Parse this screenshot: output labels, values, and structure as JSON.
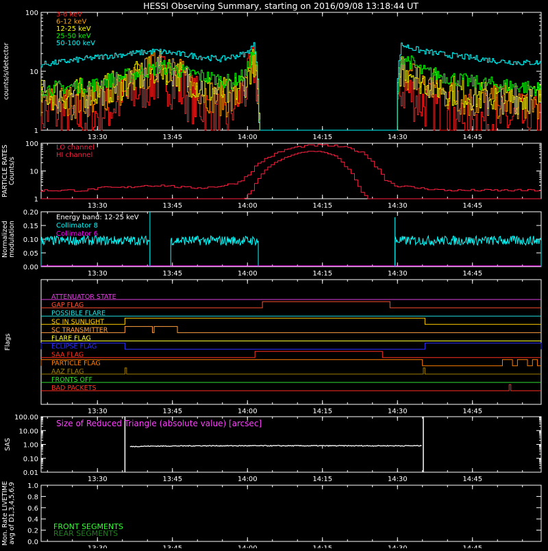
{
  "title": "HESSI Observing Summary, starting on 2016/09/08 13:18:44 UT",
  "time_axis": {
    "start": "13:18:44",
    "end": "14:58:44",
    "ticks": [
      "13:30",
      "13:45",
      "14:00",
      "14:15",
      "14:30",
      "14:45"
    ]
  },
  "chart_data": [
    {
      "name": "count-rates",
      "type": "line",
      "ylabel": "counts/s/detector",
      "yscale": "log",
      "ylim": [
        1,
        100
      ],
      "yticks": [
        "1",
        "10",
        "100"
      ],
      "series": [
        {
          "name": "3-6 keV",
          "color": "#ff2020",
          "x": [
            "13:18:44",
            "13:22",
            "13:28",
            "13:33",
            "13:37",
            "13:40",
            "13:43",
            "13:48",
            "13:52",
            "13:56",
            "14:00",
            "14:01:30",
            "14:02:30",
            "14:29",
            "14:30",
            "14:31",
            "14:35",
            "14:40",
            "14:45",
            "14:50",
            "14:55",
            "14:58:44"
          ],
          "y": [
            2,
            2,
            1.5,
            2.5,
            4,
            6,
            8,
            4,
            2.2,
            1.5,
            5,
            12,
            1,
            1,
            1,
            5,
            3,
            1.8,
            1.5,
            1.5,
            1.5,
            1.5
          ]
        },
        {
          "name": "6-12 keV",
          "color": "#ffa000",
          "x": [
            "13:18:44",
            "13:25",
            "13:30",
            "13:35",
            "13:40",
            "13:43",
            "13:47",
            "13:52",
            "13:57",
            "14:00",
            "14:01:30",
            "14:02:30",
            "14:29",
            "14:30",
            "14:31",
            "14:35",
            "14:40",
            "14:45",
            "14:50",
            "14:55",
            "14:58:44"
          ],
          "y": [
            3,
            3,
            3.5,
            5,
            9,
            14,
            8,
            4,
            3,
            5,
            14,
            1,
            1,
            1,
            11,
            6,
            4,
            3,
            3,
            3,
            3
          ]
        },
        {
          "name": "12-25 keV",
          "color": "#ffff00",
          "x": [
            "13:18:44",
            "13:25",
            "13:30",
            "13:35",
            "13:40",
            "13:43",
            "13:47",
            "13:52",
            "13:57",
            "14:00",
            "14:01:30",
            "14:02:30",
            "14:29",
            "14:30",
            "14:31",
            "14:35",
            "14:40",
            "14:45",
            "14:50",
            "14:55",
            "14:58:44"
          ],
          "y": [
            4,
            4,
            4.5,
            6,
            9,
            12,
            8,
            5,
            4,
            7,
            15,
            1,
            1,
            1,
            13,
            7,
            5,
            4,
            3.5,
            3.5,
            3.5
          ]
        },
        {
          "name": "25-50 keV",
          "color": "#00ff00",
          "x": [
            "13:18:44",
            "13:25",
            "13:30",
            "13:35",
            "13:40",
            "13:43",
            "13:47",
            "13:52",
            "13:57",
            "14:00",
            "14:01:30",
            "14:02:30",
            "14:29",
            "14:30",
            "14:31",
            "14:35",
            "14:40",
            "14:45",
            "14:50",
            "14:55",
            "14:58:44"
          ],
          "y": [
            5,
            5.5,
            6,
            8,
            10,
            12,
            10,
            8,
            6.5,
            9,
            22,
            1,
            1,
            1,
            18,
            10,
            8,
            6.5,
            6,
            5.5,
            5
          ]
        },
        {
          "name": "50-100 keV",
          "color": "#00ffff",
          "x": [
            "13:18:44",
            "13:22",
            "13:27",
            "13:32",
            "13:37",
            "13:42",
            "13:46",
            "13:50",
            "13:55",
            "14:00",
            "14:01:30",
            "14:02:30",
            "14:29",
            "14:30",
            "14:31",
            "14:35",
            "14:40",
            "14:45",
            "14:50",
            "14:55",
            "14:58:44"
          ],
          "y": [
            13,
            14,
            16,
            18,
            20,
            22,
            20,
            18,
            16,
            20,
            28,
            1,
            1,
            1,
            28,
            22,
            19,
            17,
            15,
            14,
            14
          ]
        }
      ]
    },
    {
      "name": "particle-rates",
      "type": "line",
      "ylabel": "PARTICLE RATES Counts/s",
      "yscale": "log",
      "ylim": [
        1,
        100
      ],
      "yticks": [
        "1",
        "10",
        "100"
      ],
      "series": [
        {
          "name": "LO channel",
          "color": "#ff2040",
          "x": [
            "13:18:44",
            "13:24",
            "13:28",
            "13:32",
            "13:36",
            "13:40",
            "13:44",
            "13:48",
            "13:52",
            "13:56",
            "13:59",
            "14:01",
            "14:03",
            "14:06",
            "14:09",
            "14:12",
            "14:15",
            "14:18",
            "14:21",
            "14:24",
            "14:26",
            "14:28",
            "14:30",
            "14:34",
            "14:40",
            "14:46",
            "14:52",
            "14:58:44"
          ],
          "y": [
            2,
            2,
            2,
            2.5,
            2.5,
            3,
            3,
            2.5,
            2.5,
            3,
            4,
            8,
            20,
            40,
            65,
            80,
            85,
            80,
            65,
            40,
            15,
            5,
            3,
            2.5,
            2,
            2,
            2,
            2
          ]
        },
        {
          "name": "HI channel",
          "color": "#ff2040",
          "x": [
            "13:18:44",
            "14:00",
            "14:01:30",
            "14:03",
            "14:05",
            "14:08",
            "14:11",
            "14:13",
            "14:15",
            "14:18",
            "14:20",
            "14:22",
            "14:23",
            "14:24:30",
            "14:58:44"
          ],
          "y": [
            1,
            1,
            2,
            6,
            15,
            30,
            45,
            52,
            50,
            35,
            15,
            5,
            2,
            1,
            1
          ]
        }
      ]
    },
    {
      "name": "modulation",
      "type": "line",
      "ylabel": "Normalized modulation",
      "ylim": [
        0,
        0.2
      ],
      "yticks": [
        "0.00",
        "0.05",
        "0.10",
        "0.15",
        "0.20"
      ],
      "annotation": "Energy band: 12-25 keV",
      "series": [
        {
          "name": "Collimator 8",
          "color": "#00ffff",
          "segments": [
            {
              "x0": "13:18:44",
              "x1": "13:40:30",
              "mean": 0.095
            },
            {
              "x0": "13:44:40",
              "x1": "14:02:10",
              "mean": 0.095
            },
            {
              "x0": "14:29:30",
              "x1": "14:58:44",
              "mean": 0.095
            }
          ],
          "spikes": [
            {
              "x": "13:40:30",
              "y": 0.2
            },
            {
              "x": "14:29:30",
              "y": 0.18
            }
          ]
        },
        {
          "name": "Collimator 6",
          "color": "#ff00ff",
          "y": 0
        }
      ]
    },
    {
      "name": "flags",
      "type": "line",
      "ylabel": "Flags",
      "flags": [
        {
          "name": "ATTENUATOR STATE",
          "color": "#e040e0",
          "on": []
        },
        {
          "name": "GAP FLAG",
          "color": "#ff5030",
          "on": [
            [
              "14:03:00",
              "14:28:30"
            ]
          ]
        },
        {
          "name": "POSSIBLE FLARE",
          "color": "#20e0e0",
          "on": []
        },
        {
          "name": "SC IN SUNLIGHT",
          "color": "#ffd000",
          "on": [
            [
              "13:35:30",
              "14:35:30"
            ]
          ]
        },
        {
          "name": "SC TRANSMITTER",
          "color": "#ffa040",
          "on": [
            [
              "13:35:30",
              "13:41"
            ],
            [
              "13:41:20",
              "13:46"
            ]
          ]
        },
        {
          "name": "FLARE FLAG",
          "color": "#ffff30",
          "on": []
        },
        {
          "name": "ECLIPSE FLAG",
          "color": "#3030ff",
          "on": [
            [
              "13:18:44",
              "13:35:30"
            ],
            [
              "14:35:30",
              "14:58:44"
            ]
          ]
        },
        {
          "name": "SAA FLAG",
          "color": "#ff3020",
          "on": [
            [
              "14:01:30",
              "14:27"
            ]
          ]
        },
        {
          "name": "PARTICLE FLAG",
          "color": "#ff8000",
          "on": [
            [
              "13:18:44",
              "14:35"
            ],
            [
              "14:51",
              "14:53"
            ],
            [
              "14:54",
              "14:56"
            ],
            [
              "14:57",
              "14:58"
            ]
          ]
        },
        {
          "name": "AAZ FLAG",
          "color": "#a08000",
          "on": [
            [
              "13:35:30",
              "13:35:50"
            ],
            [
              "14:35:10",
              "14:35:30"
            ]
          ]
        },
        {
          "name": "FRONTS OFF",
          "color": "#30e030",
          "on": []
        },
        {
          "name": "BAD PACKETS",
          "color": "#ff3020",
          "on": [
            [
              "14:52:20",
              "14:52:40"
            ]
          ]
        }
      ]
    },
    {
      "name": "sas",
      "type": "line",
      "ylabel": "SAS",
      "yscale": "log",
      "ylim": [
        0.01,
        100
      ],
      "yticks": [
        "0.01",
        "0.10",
        "1.00",
        "10.00",
        "100.00"
      ],
      "annotation": "Size of Reduced Triangle (absolute value) [arcsec]",
      "series": [
        {
          "name": "",
          "color": "#ffffff",
          "x": [
            "13:35:30",
            "13:36:30",
            "13:40",
            "13:50",
            "14:00",
            "14:10",
            "14:20",
            "14:30",
            "14:35:10"
          ],
          "y": [
            0.8,
            0.7,
            0.75,
            0.8,
            0.8,
            0.8,
            0.8,
            0.8,
            0.8
          ],
          "spikes": [
            {
              "x": "13:35:30",
              "y": 100
            },
            {
              "x": "14:35:10",
              "y": 100
            }
          ]
        }
      ]
    },
    {
      "name": "livetime",
      "type": "line",
      "ylabel": "Mon. Rate LIVETIME avg of D1,3,4,5,6,9",
      "ylim": [
        0,
        1
      ],
      "yticks": [
        "0.0",
        "0.2",
        "0.4",
        "0.6",
        "0.8",
        "1.0"
      ],
      "series": [
        {
          "name": "FRONT SEGMENTS",
          "color": "#30ff30",
          "x": [],
          "y": []
        },
        {
          "name": "REAR SEGMENTS",
          "color": "#208020",
          "x": [],
          "y": []
        }
      ]
    }
  ]
}
